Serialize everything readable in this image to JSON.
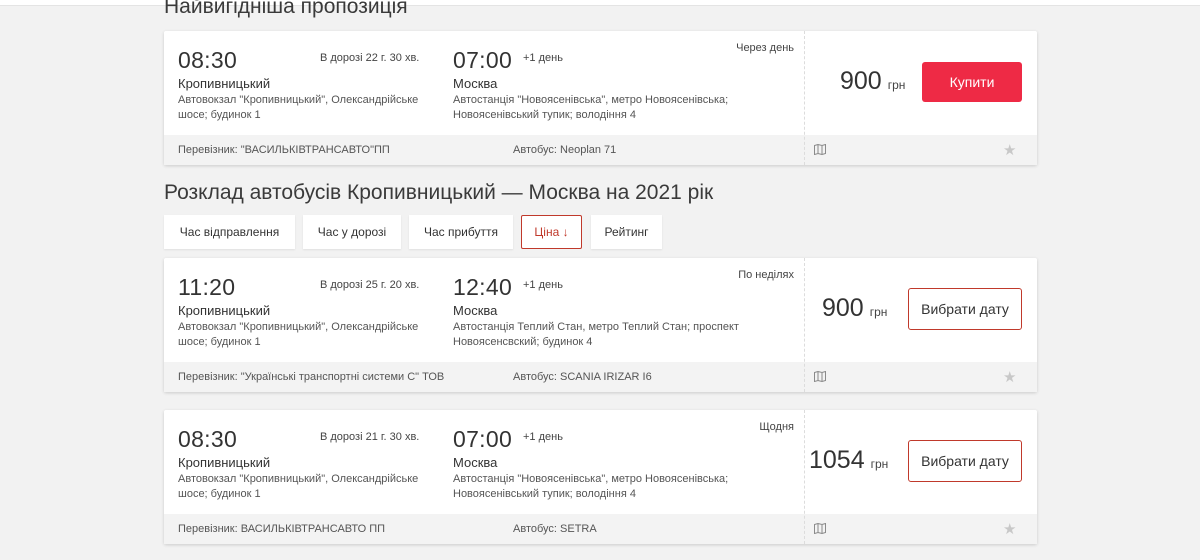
{
  "best_offer": {
    "title": "Найвигідніша пропозиція",
    "trip": {
      "dep_time": "08:30",
      "duration": "В дорозі 22 г. 30 хв.",
      "arr_time": "07:00",
      "next_day": "+1 день",
      "dep_city": "Кропивницький",
      "dep_address": "Автовокзал \"Кропивницький\", Олександрійське шосе; будинок 1",
      "arr_city": "Москва",
      "arr_address": "Автостанція \"Новоясенівська\", метро Новоясенівська; Новоясенівський тупик; володіння 4",
      "frequency": "Через день",
      "price": "900",
      "currency": "грн",
      "action_label": "Купити",
      "carrier": "Перевізник: \"ВАСИЛЬКІВТРАНСАВТО\"ПП",
      "bus": "Автобус: Neoplan 71"
    }
  },
  "schedule": {
    "title": "Розклад автобусів Кропивницький — Москва на 2021 рік",
    "sort_options": [
      {
        "label": "Час відправлення",
        "active": false
      },
      {
        "label": "Час у дорозі",
        "active": false
      },
      {
        "label": "Час прибуття",
        "active": false
      },
      {
        "label": "Ціна ↓",
        "active": true
      },
      {
        "label": "Рейтинг",
        "active": false
      }
    ],
    "trips": [
      {
        "dep_time": "11:20",
        "duration": "В дорозі 25 г. 20 хв.",
        "arr_time": "12:40",
        "next_day": "+1 день",
        "dep_city": "Кропивницький",
        "dep_address": "Автовокзал \"Кропивницький\", Олександрійське шосе; будинок 1",
        "arr_city": "Москва",
        "arr_address": "Автостанція Теплий Стан, метро Теплий Стан; проспект Новоясенсвский; будинок 4",
        "frequency": "По неділях",
        "price": "900",
        "currency": "грн",
        "action_label": "Вибрати дату",
        "carrier": "Перевізник: \"Українські транспортні системи С\" ТОВ",
        "bus": "Автобус: SCANIA IRIZAR I6"
      },
      {
        "dep_time": "08:30",
        "duration": "В дорозі 21 г. 30 хв.",
        "arr_time": "07:00",
        "next_day": "+1 день",
        "dep_city": "Кропивницький",
        "dep_address": "Автовокзал \"Кропивницький\", Олександрійське шосе; будинок 1",
        "arr_city": "Москва",
        "arr_address": "Автостанція \"Новоясенівська\", метро Новоясенівська; Новоясенівський тупик; володіння 4",
        "frequency": "Щодня",
        "price": "1054",
        "currency": "грн",
        "action_label": "Вибрати дату",
        "carrier": "Перевізник: ВАСИЛЬКІВТРАНСАВТО ПП",
        "bus": "Автобус: SETRA"
      }
    ]
  },
  "icons": {
    "map": "map-icon",
    "favorite": "star-icon"
  },
  "colors": {
    "accent": "#ee2a45",
    "outline": "#c0392b"
  }
}
